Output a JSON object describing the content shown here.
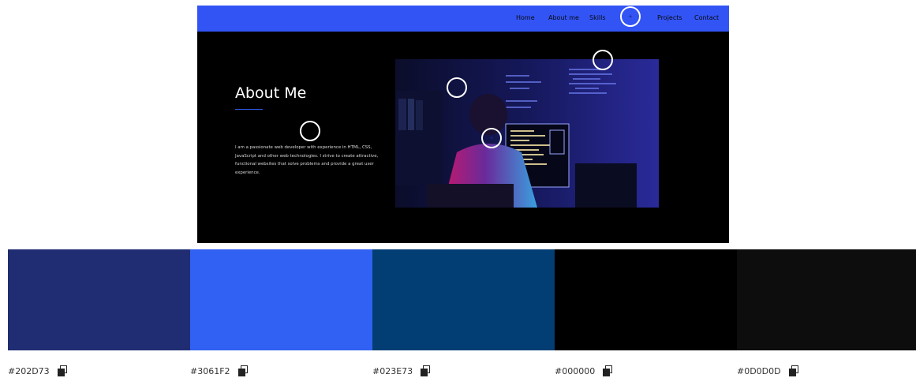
{
  "preview": {
    "nav": {
      "background": "#3254F5",
      "items": [
        "Home",
        "About me",
        "Skills",
        "Projects",
        "Contact"
      ]
    },
    "about": {
      "heading": "About Me",
      "paragraph": "I am a passionate web developer with experience in HTML, CSS, JavaScript and other web technologies. I strive to create attractive, functional websites that solve problems and provide a great user experience."
    },
    "hotspots": [
      "plus-icon",
      "plus-icon",
      "plus-icon",
      "plus-icon",
      "plus-icon"
    ]
  },
  "palette": {
    "swatches": [
      {
        "hex": "#202D73",
        "label": "#202D73"
      },
      {
        "hex": "#3061F2",
        "label": "#3061F2"
      },
      {
        "hex": "#023E73",
        "label": "#023E73"
      },
      {
        "hex": "#000000",
        "label": "#000000"
      },
      {
        "hex": "#0D0D0D",
        "label": "#0D0D0D"
      }
    ],
    "copy_icon": "copy-icon"
  }
}
